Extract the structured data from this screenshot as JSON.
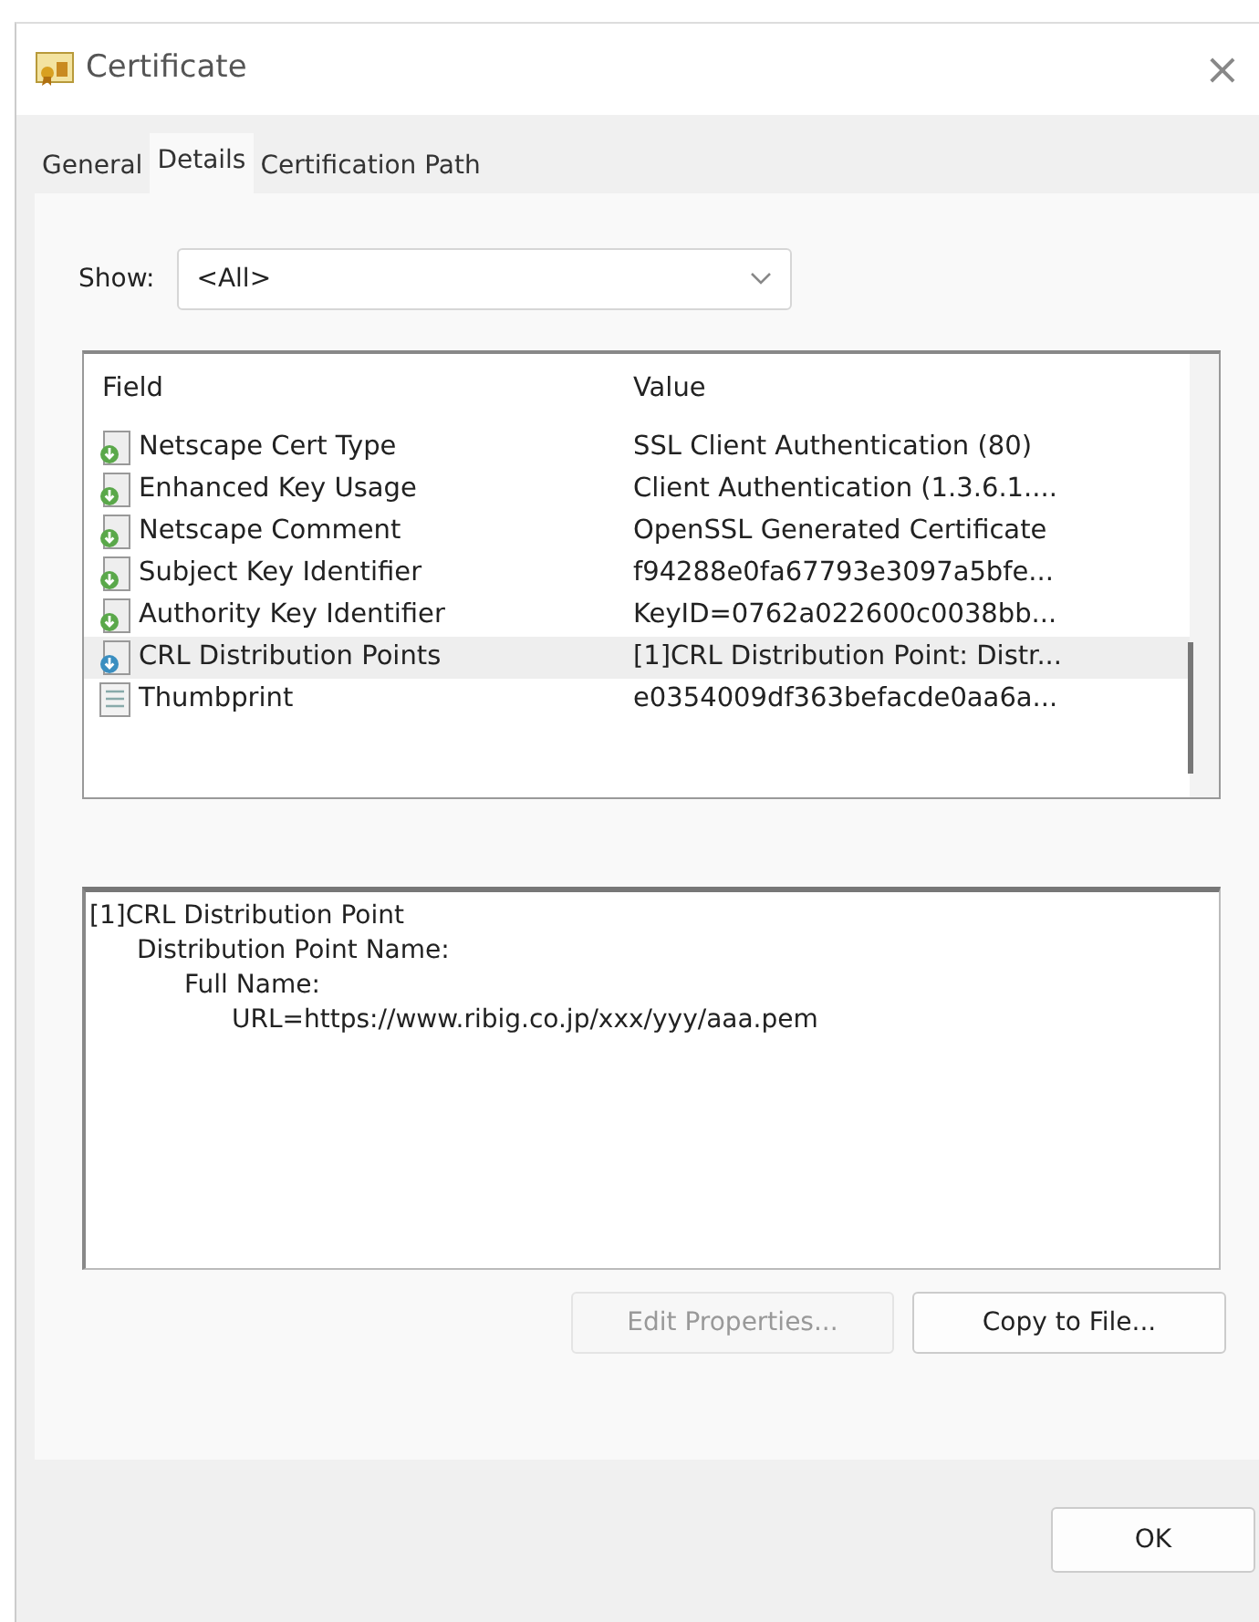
{
  "window": {
    "title": "Certificate",
    "close": "×"
  },
  "tabs": [
    {
      "label": "General",
      "selected": false
    },
    {
      "label": "Details",
      "selected": true
    },
    {
      "label": "Certification Path",
      "selected": false
    }
  ],
  "show": {
    "label": "Show:",
    "value": "<All>"
  },
  "table": {
    "columns": [
      "Field",
      "Value"
    ],
    "rows": [
      {
        "kind": "extension",
        "field": "Netscape Cert Type",
        "value": "SSL Client Authentication (80)",
        "selected": false
      },
      {
        "kind": "extension",
        "field": "Enhanced Key Usage",
        "value": "Client Authentication (1.3.6.1....",
        "selected": false
      },
      {
        "kind": "extension",
        "field": "Netscape Comment",
        "value": "OpenSSL Generated Certificate",
        "selected": false
      },
      {
        "kind": "extension",
        "field": "Subject Key Identifier",
        "value": "f94288e0fa67793e3097a5bfe...",
        "selected": false
      },
      {
        "kind": "extension",
        "field": "Authority Key Identifier",
        "value": "KeyID=0762a022600c0038bb...",
        "selected": false
      },
      {
        "kind": "extension",
        "field": "CRL Distribution Points",
        "value": "[1]CRL Distribution Point: Distr...",
        "selected": true
      },
      {
        "kind": "property",
        "field": "Thumbprint",
        "value": "e0354009df363befacde0aa6a...",
        "selected": false
      }
    ]
  },
  "detail": [
    {
      "text": "[1]CRL Distribution Point",
      "children": [
        {
          "text": "Distribution Point Name:",
          "children": [
            {
              "text": "Full Name:",
              "children": [
                {
                  "text": "URL=https://www.ribig.co.jp/xxx/yyy/aaa.pem"
                }
              ]
            }
          ]
        }
      ]
    }
  ],
  "buttons": [
    {
      "label": "Edit Properties...",
      "disabled": true
    },
    {
      "label": "Copy to File...",
      "disabled": false
    }
  ],
  "footer_buttons": [
    {
      "label": "OK",
      "disabled": false
    }
  ]
}
